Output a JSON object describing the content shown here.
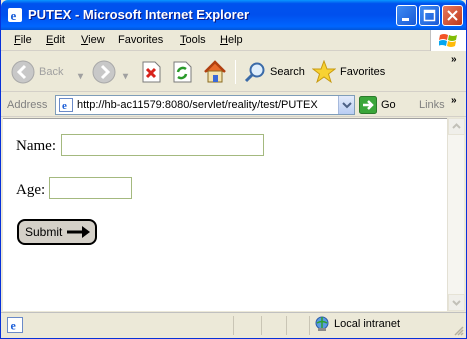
{
  "window": {
    "title": "PUTEX - Microsoft Internet Explorer"
  },
  "menu": {
    "items": [
      {
        "label": "File",
        "key": "F",
        "rest": "ile"
      },
      {
        "label": "Edit",
        "key": "E",
        "rest": "dit"
      },
      {
        "label": "View",
        "key": "V",
        "rest": "iew"
      },
      {
        "label": "Favorites",
        "key": "",
        "rest": "Favorites"
      },
      {
        "label": "Tools",
        "key": "T",
        "rest": "ools"
      },
      {
        "label": "Help",
        "key": "H",
        "rest": "elp"
      }
    ]
  },
  "toolbar": {
    "back_label": "Back",
    "search_label": "Search",
    "favorites_label": "Favorites"
  },
  "address": {
    "label": "Address",
    "url": "http://hb-ac11579:8080/servlet/reality/test/PUTEX",
    "go_label": "Go",
    "links_label": "Links"
  },
  "form": {
    "name_label": "Name:",
    "name_value": "",
    "age_label": "Age:",
    "age_value": "",
    "submit_label": "Submit"
  },
  "status": {
    "zone_label": "Local intranet"
  },
  "colors": {
    "titlebar": "#0053ee",
    "chrome": "#ece9d8",
    "input_border": "#a4b97f"
  }
}
